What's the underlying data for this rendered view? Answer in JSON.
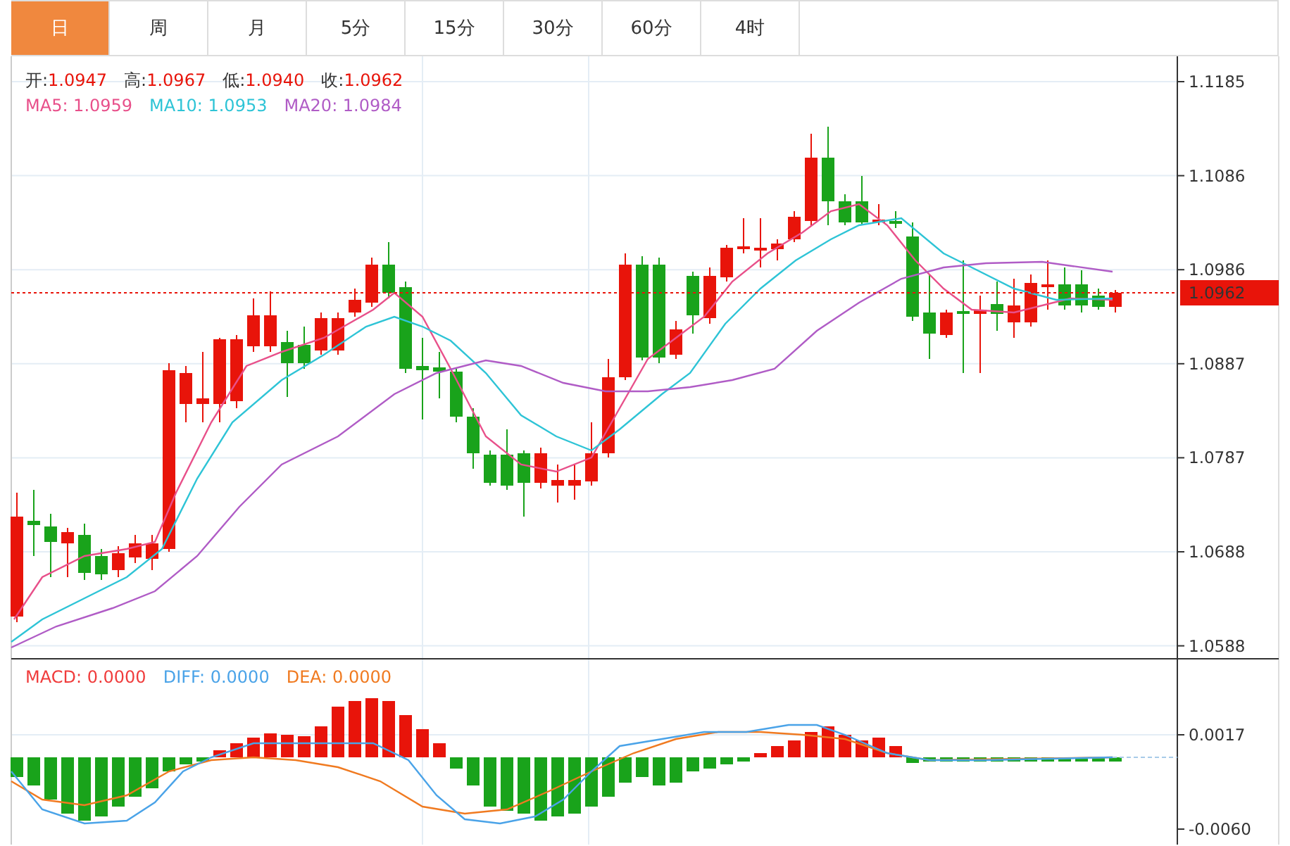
{
  "tabs": [
    {
      "label": "日",
      "selected": true
    },
    {
      "label": "周",
      "selected": false
    },
    {
      "label": "月",
      "selected": false
    },
    {
      "label": "5分",
      "selected": false
    },
    {
      "label": "15分",
      "selected": false
    },
    {
      "label": "30分",
      "selected": false
    },
    {
      "label": "60分",
      "selected": false
    },
    {
      "label": "4时",
      "selected": false
    }
  ],
  "quote": [
    {
      "label": "开:",
      "value": "1.0947"
    },
    {
      "label": "高:",
      "value": "1.0967"
    },
    {
      "label": "低:",
      "value": "1.0940"
    },
    {
      "label": "收:",
      "value": "1.0962"
    }
  ],
  "moving_averages": [
    {
      "label": "MA5: 1.0959",
      "color": "#e8508a"
    },
    {
      "label": "MA10: 1.0953",
      "color": "#2ec4d6"
    },
    {
      "label": "MA20: 1.0984",
      "color": "#b05cc6"
    }
  ],
  "price_axis": [
    "1.1185",
    "1.1086",
    "1.0986",
    "1.0887",
    "1.0787",
    "1.0688",
    "1.0588"
  ],
  "current_price": "1.0962",
  "macd_legend": [
    {
      "label": "MACD: 0.0000",
      "color": "#f03c3c"
    },
    {
      "label": "DIFF: 0.0000",
      "color": "#4aa3e8"
    },
    {
      "label": "DEA: 0.0000",
      "color": "#f07a20"
    }
  ],
  "macd_axis": [
    "0.0017",
    "-0.0060"
  ]
}
